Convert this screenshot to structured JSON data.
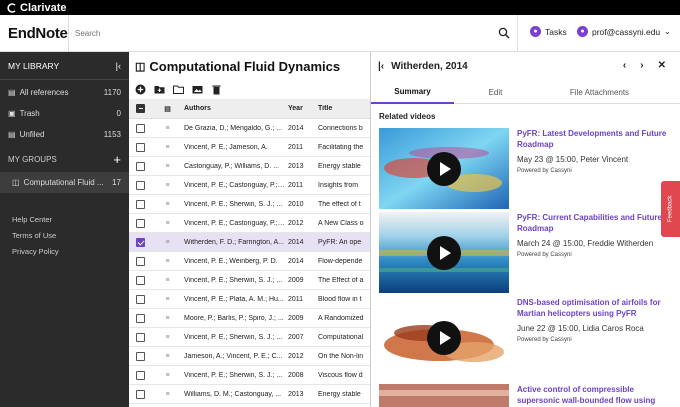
{
  "topbar": {
    "brand": "Clarivate"
  },
  "header": {
    "logo": "EndNote",
    "search_placeholder": "Search",
    "tasks_label": "Tasks",
    "user_email": "prof@cassyni.edu"
  },
  "sidebar": {
    "library_label": "MY LIBRARY",
    "items": [
      {
        "label": "All references",
        "count": "1170"
      },
      {
        "label": "Trash",
        "count": "0"
      },
      {
        "label": "Unfiled",
        "count": "1153"
      }
    ],
    "groups_label": "MY GROUPS",
    "group": {
      "label": "Computational Fluid ...",
      "count": "17"
    },
    "links": [
      "Help Center",
      "Terms of Use",
      "Privacy Policy"
    ]
  },
  "main": {
    "title": "Computational Fluid Dynamics",
    "columns": {
      "authors": "Authors",
      "year": "Year",
      "title": "Title"
    },
    "rows": [
      {
        "authors": "De Grazia, D.; Mengaldo, G.; ...",
        "year": "2014",
        "title": "Connections b",
        "selected": false
      },
      {
        "authors": "Vincent, P. E.; Jameson, A.",
        "year": "2011",
        "title": "Facilitating the",
        "selected": false
      },
      {
        "authors": "Castonguay, P.; Williams, D. ...",
        "year": "2013",
        "title": "Energy stable",
        "selected": false
      },
      {
        "authors": "Vincent, P. E.; Castonguay, P.; ...",
        "year": "2011",
        "title": "Insights from",
        "selected": false
      },
      {
        "authors": "Vincent, P. E.; Sherwin, S. J.; ...",
        "year": "2010",
        "title": "The effect of t",
        "selected": false
      },
      {
        "authors": "Vincent, P. E.; Castonguay, P.; ...",
        "year": "2012",
        "title": "A New Class o",
        "selected": false
      },
      {
        "authors": "Witherden, F. D.; Farrington, A...",
        "year": "2014",
        "title": "PyFR: An ope",
        "selected": true
      },
      {
        "authors": "Vincent, P. E.; Weinberg, P. D.",
        "year": "2014",
        "title": "Flow-depende",
        "selected": false
      },
      {
        "authors": "Vincent, P. E.; Sherwin, S. J.; ...",
        "year": "2009",
        "title": "The Effect of a",
        "selected": false
      },
      {
        "authors": "Vincent, P. E.; Plata, A. M.; Hu...",
        "year": "2011",
        "title": "Blood flow in t",
        "selected": false
      },
      {
        "authors": "Moore, P.; Barlis, P.; Spiro, J.; ...",
        "year": "2009",
        "title": "A Randomized",
        "selected": false
      },
      {
        "authors": "Vincent, P. E.; Sherwin, S. J.; ...",
        "year": "2007",
        "title": "Computational",
        "selected": false
      },
      {
        "authors": "Jameson, A.; Vincent, P. E.; C...",
        "year": "2012",
        "title": "On the Non-lin",
        "selected": false
      },
      {
        "authors": "Vincent, P. E.; Sherwin, S. J.; ...",
        "year": "2008",
        "title": "Viscous flow d",
        "selected": false
      },
      {
        "authors": "Williams, D. M.; Castonguay, ...",
        "year": "2013",
        "title": "Energy stable",
        "selected": false
      }
    ]
  },
  "panel": {
    "title": "Witherden, 2014",
    "tabs": [
      "Summary",
      "Edit",
      "File Attachments"
    ],
    "related_label": "Related videos",
    "videos": [
      {
        "title": "PyFR: Latest Developments and Future Roadmap",
        "meta": "May 23 @ 15:00, Peter Vincent",
        "powered": "Powered by Cassyni"
      },
      {
        "title": "PyFR: Current Capabilities and Future Roadmap",
        "meta": "March 24 @ 15:00, Freddie Witherden",
        "powered": "Powered by Cassyni"
      },
      {
        "title": "DNS-based optimisation of airfoils for Martian helicopters using PyFR",
        "meta": "June 22 @ 15:00, Lidia Caros Roca",
        "powered": "Powered by Cassyni"
      },
      {
        "title": "Active control of compressible supersonic wall-bounded flow using direct numeric...",
        "meta": "",
        "powered": ""
      }
    ]
  },
  "feedback": "Feedback",
  "colors": {
    "accent": "#6c42c9",
    "sidebar_bg": "#2b2b2b",
    "feedback": "#e0474f"
  }
}
